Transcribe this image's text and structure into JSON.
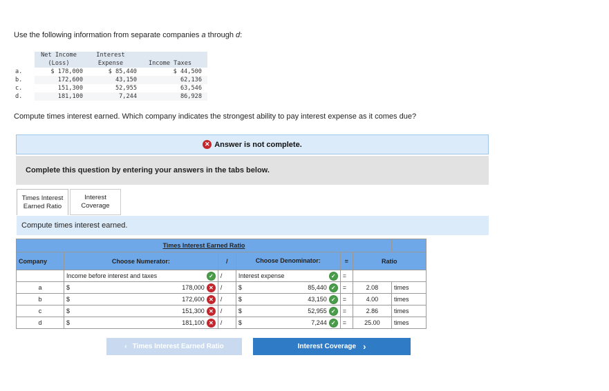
{
  "intro": {
    "text_before": "Use the following information from separate companies ",
    "a": "a",
    "through": " through ",
    "d": "d",
    "colon": ":"
  },
  "source_table": {
    "headers": [
      "Net Income\n(Loss)",
      "Interest\nExpense",
      "Income Taxes"
    ],
    "rows": [
      {
        "label": "a.",
        "net_income": "$ 178,000",
        "interest": "$ 85,440",
        "taxes": "$ 44,500"
      },
      {
        "label": "b.",
        "net_income": "172,600",
        "interest": "43,150",
        "taxes": "62,136"
      },
      {
        "label": "c.",
        "net_income": "151,300",
        "interest": "52,955",
        "taxes": "63,546"
      },
      {
        "label": "d.",
        "net_income": "181,100",
        "interest": "7,244",
        "taxes": "86,928"
      }
    ]
  },
  "question": "Compute times interest earned. Which company indicates the strongest ability to pay interest expense as it comes due?",
  "banner": {
    "icon": "x-circle-icon",
    "text": "Answer is not complete."
  },
  "instruction": "Complete this question by entering your answers in the tabs below.",
  "tabs": [
    {
      "label": "Times Interest Earned Ratio",
      "active": true
    },
    {
      "label": "Interest Coverage",
      "active": false
    }
  ],
  "subheader": "Compute times interest earned.",
  "grid": {
    "title": "Times Interest Earned Ratio",
    "col_company": "Company",
    "col_numerator": "Choose Numerator:",
    "divide": "/",
    "col_denominator": "Choose Denominator:",
    "equals": "=",
    "col_ratio": "Ratio",
    "numerator_select": "Income before interest and taxes",
    "denominator_select": "Interest expense",
    "rows": [
      {
        "company": "a",
        "cur1": "$",
        "numerator": "178,000",
        "cur2": "$",
        "denominator": "85,440",
        "ratio": "2.08",
        "unit": "times"
      },
      {
        "company": "b",
        "cur1": "$",
        "numerator": "172,600",
        "cur2": "$",
        "denominator": "43,150",
        "ratio": "4.00",
        "unit": "times"
      },
      {
        "company": "c",
        "cur1": "$",
        "numerator": "151,300",
        "cur2": "$",
        "denominator": "52,955",
        "ratio": "2.86",
        "unit": "times"
      },
      {
        "company": "d",
        "cur1": "$",
        "numerator": "181,100",
        "cur2": "$",
        "denominator": "7,244",
        "ratio": "25.00",
        "unit": "times"
      }
    ]
  },
  "nav": {
    "prev_label": "Times Interest Earned Ratio",
    "next_label": "Interest Coverage",
    "prev_icon": "chevron-left-icon",
    "next_icon": "chevron-right-icon"
  },
  "colors": {
    "header_blue": "#6fa8e8",
    "banner_bg": "#dcebf9",
    "error_red": "#c1272d",
    "ok_green": "#4a9d4a",
    "next_button": "#2f7bc5"
  }
}
